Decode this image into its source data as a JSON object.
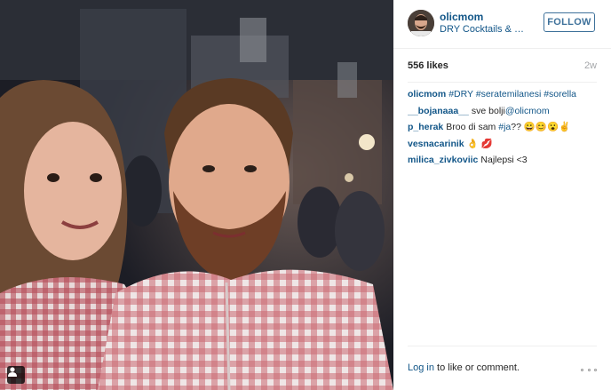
{
  "post": {
    "photo": {
      "icon": "user-tag-icon"
    },
    "header": {
      "username": "olicmom",
      "location": "DRY Cocktails & Pi...",
      "follow_label": "FOLLOW"
    },
    "likes": "556 likes",
    "time": "2w",
    "comments": [
      {
        "author": "olicmom",
        "text": "#DRY #seratemilanesi #sorella"
      },
      {
        "author": "__bojanaaa__",
        "text": "sve bolji@olicmom"
      },
      {
        "author": "p_herak",
        "text": "Broo di sam #ja?? 😀😊😮✌"
      },
      {
        "author": "vesnacarinik",
        "text": "👌 💋"
      },
      {
        "author": "milica_zivkoviic",
        "text": "Najlepsi <3"
      }
    ],
    "footer": {
      "login_link": "Log in",
      "login_rest": " to like or comment."
    },
    "colors": {
      "link": "#125688",
      "follow_border": "#3f729b",
      "muted": "#a5a7aa"
    }
  }
}
